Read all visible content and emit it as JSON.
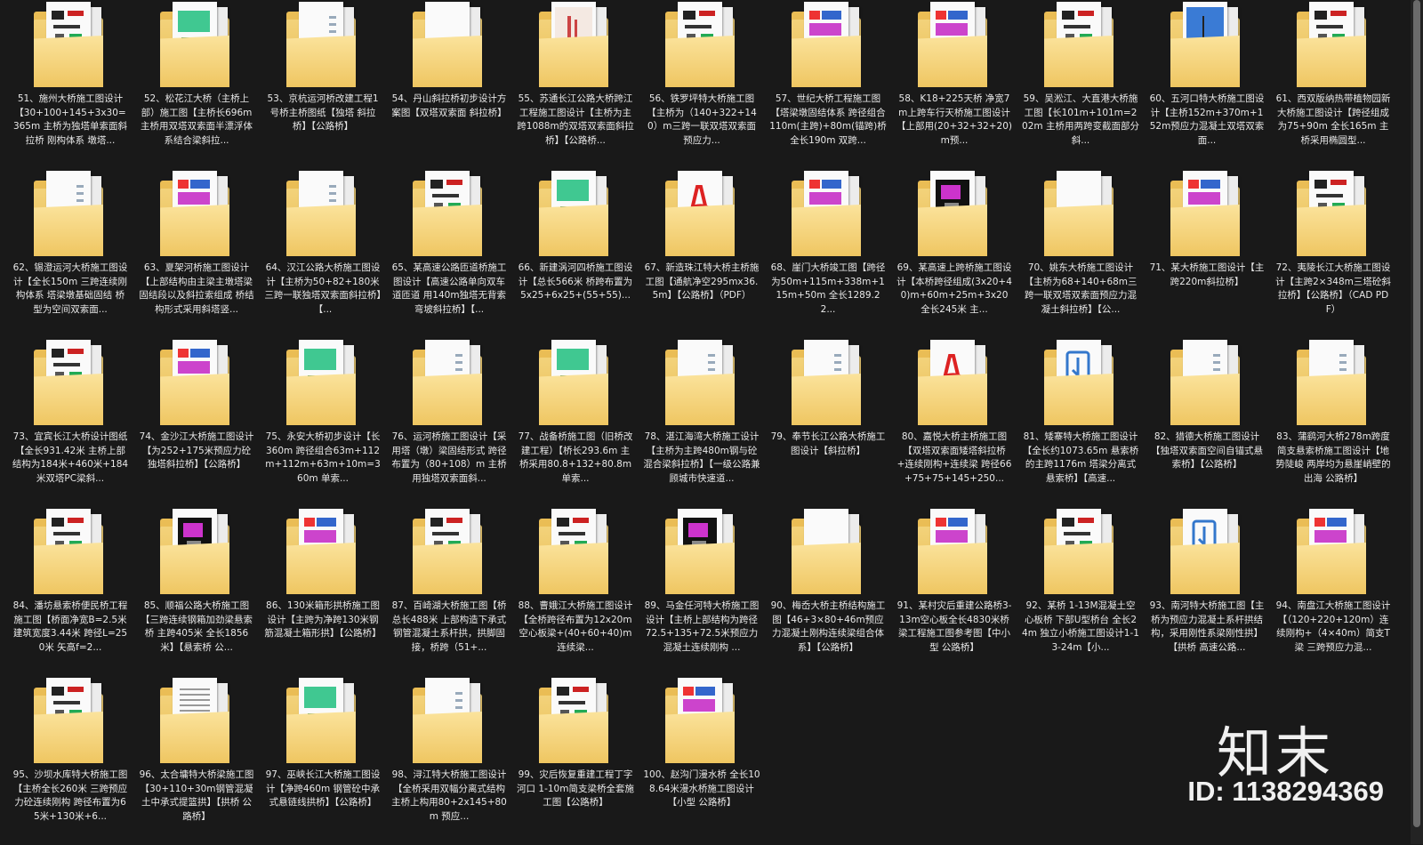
{
  "items": [
    {
      "caption": "51、施州大桥施工图设计【30+100+145+3x30=365m 主桥为独塔单索面斜拉桥 刚构体系 墩塔...",
      "kind": "cad"
    },
    {
      "caption": "52、松花江大桥（主桥上部）施工图【主桥长696m 主桥用双塔双索面半漂浮体系结合梁斜拉...",
      "kind": "green"
    },
    {
      "caption": "53、京杭运河桥改建工程1号桥主桥图纸【独塔 斜拉桥】【公路桥】",
      "kind": "doc"
    },
    {
      "caption": "54、丹山斜拉桥初步设计方案图【双塔双索面 斜拉桥】",
      "kind": "blank"
    },
    {
      "caption": "55、苏通长江公路大桥跨江工程施工图设计【主桥为主跨1088m的双塔双索面斜拉桥】【公路桥...",
      "kind": "cover"
    },
    {
      "caption": "56、铁罗坪特大桥施工图【主桥为（140+322+140）m三跨一联双塔双索面预应力...",
      "kind": "cad"
    },
    {
      "caption": "57、世纪大桥工程施工图【塔梁墩固结体系 跨径组合110m(主跨)+80m(锚跨)桥全长190m 双跨...",
      "kind": "color"
    },
    {
      "caption": "58、K18+225天桥 净宽7m上跨车行天桥施工图设计【上部用(20+32+32+20)m预...",
      "kind": "color"
    },
    {
      "caption": "59、吴淞江、大直港大桥施工图【长101m+101m=202m 主桥用两跨变截面部分斜...",
      "kind": "cad"
    },
    {
      "caption": "60、五河口特大桥施工图设计【主桥152m+370m+152m预应力混凝土双塔双索面...",
      "kind": "photo"
    },
    {
      "caption": "61、西双版纳热带植物园新大桥施工图设计【跨径组成为75+90m 全长165m 主桥采用椭圆型...",
      "kind": "cad"
    },
    {
      "caption": "62、锡澄运河大桥施工图设计【全长150m 三跨连续刚构体系 塔梁墩基础固结 桥型为空间双索面...",
      "kind": "doc"
    },
    {
      "caption": "63、夏架河桥施工图设计【上部结构由主梁主墩塔梁固结段以及斜拉索组成 桥结构形式采用斜塔竖...",
      "kind": "color"
    },
    {
      "caption": "64、汉江公路大桥施工图设计【主桥为50+82+180米三跨一联独塔双索面斜拉桥】【...",
      "kind": "doc"
    },
    {
      "caption": "65、某高速公路匝道桥施工图设计【高速公路单向双车道匝道 用140m独塔无背索弯坡斜拉桥】【...",
      "kind": "cad"
    },
    {
      "caption": "66、新建涡河四桥施工图设计【总长566米 桥跨布置为5x25+6x25+(55+55)...",
      "kind": "green"
    },
    {
      "caption": "67、新造珠江特大桥主桥施工图【通航净空295mx36.5m】【公路桥】（PDF）",
      "kind": "pdf"
    },
    {
      "caption": "68、崖门大桥竣工图【跨径为50m+115m+338m+115m+50m 全长1289.22...",
      "kind": "color"
    },
    {
      "caption": "69、某高速上跨桥施工图设计【本桥跨径组成(3x20+40)m+60m+25m+3x20 全长245米 主...",
      "kind": "dark"
    },
    {
      "caption": "70、姚东大桥施工图设计【主桥为68+140+68m三跨一联双塔双索面预应力混凝土斜拉桥】【公...",
      "kind": "blank"
    },
    {
      "caption": "71、某大桥施工图设计【主跨220m斜拉桥】",
      "kind": "color"
    },
    {
      "caption": "72、夷陵长江大桥施工图设计【主跨2×348m三塔砼斜拉桥】【公路桥】（CAD PDF）",
      "kind": "cad"
    },
    {
      "caption": "73、宜宾长江大桥设计图纸【全长931.42米 主桥上部结构为184米+460米+184米双塔PC梁斜...",
      "kind": "cad"
    },
    {
      "caption": "74、金沙江大桥施工图设计【为252+175米预应力砼独塔斜拉桥】【公路桥】",
      "kind": "color"
    },
    {
      "caption": "75、永安大桥初步设计【长360m 跨径组合63m+112m+112m+63m+10m=360m 单索...",
      "kind": "green"
    },
    {
      "caption": "76、运河桥施工图设计【采用塔（墩）梁固结形式 跨径布置为（80+108）m 主桥用独塔双索面斜...",
      "kind": "doc"
    },
    {
      "caption": "77、战备桥施工图（旧桥改建工程）【桥长293.6m 主桥采用80.8+132+80.8m单索...",
      "kind": "green"
    },
    {
      "caption": "78、湛江海湾大桥施工设计【主桥为主跨480m钢与砼混合梁斜拉桥】【一级公路兼顾城市快速道...",
      "kind": "doc"
    },
    {
      "caption": "79、奉节长江公路大桥施工图设计【斜拉桥】",
      "kind": "doc"
    },
    {
      "caption": "80、嘉悦大桥主桥施工图【双塔双索面矮塔斜拉桥+连续刚构+连续梁 跨径66+75+75+145+250...",
      "kind": "pdf"
    },
    {
      "caption": "81、矮寨特大桥施工图设计【全长约1073.65m 悬索桥的主跨1176m 塔梁分离式悬索桥】【高速...",
      "kind": "blue"
    },
    {
      "caption": "82、猎德大桥施工图设计【独塔双索面空间自锚式悬索桥】【公路桥】",
      "kind": "doc"
    },
    {
      "caption": "83、蒲鹞河大桥278m跨度简支悬索桥施工图设计【地势陡峻 两岸均为悬崖峭壁的出海 公路桥】",
      "kind": "doc"
    },
    {
      "caption": "84、潘坊悬索桥便民桥工程施工图【桥面净宽B=2.5米 建筑宽度3.44米 跨径L=250米 矢高f=2...",
      "kind": "cad"
    },
    {
      "caption": "85、顺福公路大桥施工图【三跨连续钢箱加劲梁悬索桥 主跨405米 全长1856米】【悬索桥 公...",
      "kind": "dark"
    },
    {
      "caption": "86、130米箱形拱桥施工图设计【主跨为净跨130米钢筋混凝土箱形拱】【公路桥】",
      "kind": "color"
    },
    {
      "caption": "87、百崎湖大桥施工图【桥总长488米 上部构造下承式钢管混凝土系杆拱，拱脚固接，桥跨（51+...",
      "kind": "cad"
    },
    {
      "caption": "88、曹娥江大桥施工图设计【全桥跨径布置为12x20m空心板梁+(40+60+40)m连续梁...",
      "kind": "cad"
    },
    {
      "caption": "89、马金任河特大桥施工图设计【主桥上部结构为跨径72.5+135+72.5米预应力混凝土连续刚构 ...",
      "kind": "dark"
    },
    {
      "caption": "90、梅岙大桥主桥结构施工图【46+3×80+46m预应力混凝土刚构连续梁组合体系】【公路桥】",
      "kind": "blank"
    },
    {
      "caption": "91、某村灾后重建公路桥3-13m空心板全长4830米桥梁工程施工图参考图【中小型 公路桥】",
      "kind": "color"
    },
    {
      "caption": "92、某桥 1-13M混凝土空心板桥 下部U型桥台 全长24m 独立小桥施工图设计1-13-24m【小...",
      "kind": "cad"
    },
    {
      "caption": "93、南河特大桥施工图【主桥为预应力混凝土系杆拱结构，采用刚性系梁刚性拱】【拱桥 高速公路...",
      "kind": "blue"
    },
    {
      "caption": "94、南盘江大桥施工图设计【（120+220+120m）连续刚构+（4×40m）简支T梁 三跨预应力混...",
      "kind": "color"
    },
    {
      "caption": "95、沙坝水库特大桥施工图【主桥全长260米 三跨预应力砼连续刚构 跨径布置为65米+130米+6...",
      "kind": "cad"
    },
    {
      "caption": "96、太合墉特大桥梁施工图【30+110+30m钢管混凝土中承式提篮拱】【拱桥 公路桥】",
      "kind": "text"
    },
    {
      "caption": "97、巫峡长江大桥施工图设计【净跨460m 钢管砼中承式悬链线拱桥】【公路桥】",
      "kind": "green"
    },
    {
      "caption": "98、浔江特大桥施工图设计【全桥采用双幅分离式结构 主桥上构用80+2x145+80m 预应...",
      "kind": "doc"
    },
    {
      "caption": "99、灾后恢复重建工程丁字河口 1-10m简支梁桥全套施工图【公路桥】",
      "kind": "cad"
    },
    {
      "caption": "100、赵沟门漫水桥 全长108.64米漫水桥施工图设计【小型 公路桥】",
      "kind": "color"
    }
  ],
  "watermark": {
    "logo": "知末",
    "id": "ID: 1138294369"
  }
}
